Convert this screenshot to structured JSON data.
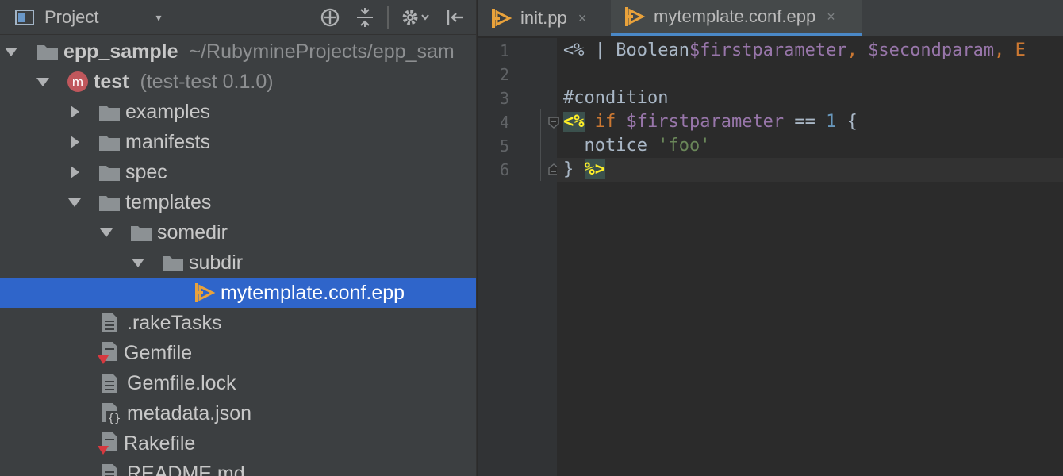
{
  "project_panel": {
    "title": "Project",
    "dropdown_glyph": "▾",
    "toolbar_icons": [
      "project-view-icon",
      "locate-icon",
      "collapse-all-icon",
      "gear-icon",
      "hide-panel-icon"
    ],
    "tree": [
      {
        "label": "epp_sample",
        "hint": "~/RubymineProjects/epp_sam",
        "bold": true,
        "expanded": true,
        "icon": "folder-icon"
      },
      {
        "label": "test",
        "hint": "(test-test 0.1.0)",
        "bold": true,
        "expanded": true,
        "icon": "module-icon",
        "module_letter": "m"
      },
      {
        "label": "examples",
        "expanded": false,
        "icon": "folder-icon"
      },
      {
        "label": "manifests",
        "expanded": false,
        "icon": "folder-icon"
      },
      {
        "label": "spec",
        "expanded": false,
        "icon": "folder-icon"
      },
      {
        "label": "templates",
        "expanded": true,
        "icon": "folder-icon"
      },
      {
        "label": "somedir",
        "expanded": true,
        "icon": "folder-icon"
      },
      {
        "label": "subdir",
        "expanded": true,
        "icon": "folder-icon"
      },
      {
        "label": "mytemplate.conf.epp",
        "selected": true,
        "icon": "epp-file-icon"
      },
      {
        "label": ".rakeTasks",
        "icon": "text-file-icon"
      },
      {
        "label": "Gemfile",
        "icon": "ruby-file-icon"
      },
      {
        "label": "Gemfile.lock",
        "icon": "text-file-icon"
      },
      {
        "label": "metadata.json",
        "icon": "json-file-icon",
        "icon_text": "{}"
      },
      {
        "label": "Rakefile",
        "icon": "ruby-file-icon"
      },
      {
        "label": "README.md",
        "icon": "text-file-icon"
      }
    ]
  },
  "editor": {
    "tabs": [
      {
        "label": "init.pp",
        "icon": "puppet-file-icon",
        "close": "×",
        "active": false
      },
      {
        "label": "mytemplate.conf.epp",
        "icon": "epp-file-icon",
        "close": "×",
        "active": true
      }
    ],
    "line_numbers": [
      "1",
      "2",
      "3",
      "4",
      "5",
      "6"
    ],
    "code": {
      "line1": {
        "open": "<%",
        "pipe": " | ",
        "type": "Boolean",
        "p1": "$firstparameter",
        "comma": ", ",
        "p2": "$secondparam",
        "rest": ", E"
      },
      "line3": {
        "comment": "#condition"
      },
      "line4": {
        "open": "<%",
        "kw": "if",
        "var": "$firstparameter",
        "op": " == ",
        "num": "1",
        "brace": " {"
      },
      "line5": {
        "indent": "  ",
        "ident": "notice ",
        "str": "'foo'"
      },
      "line6": {
        "brace": "} ",
        "close": "%>"
      }
    },
    "colors": {
      "keyword": "#cc7832",
      "variable": "#9876aa",
      "number": "#6897bb",
      "string": "#6a8759",
      "tag": "#ffef28",
      "selection": "#2f65ca"
    }
  }
}
